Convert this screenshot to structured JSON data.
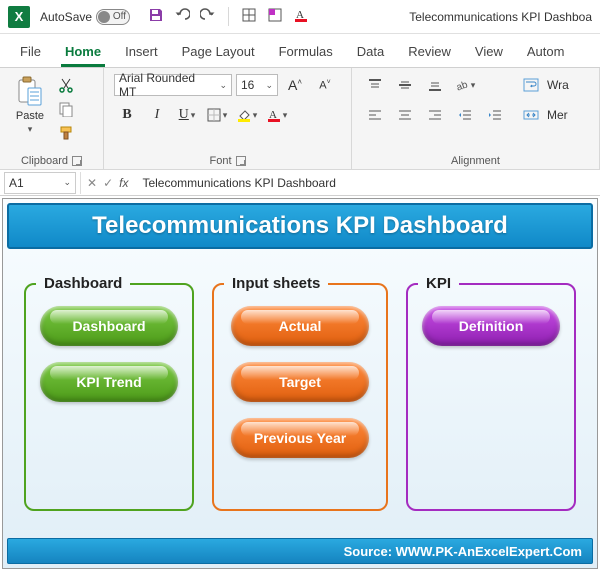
{
  "titlebar": {
    "autosave_label": "AutoSave",
    "autosave_state": "Off",
    "document_title": "Telecommunications KPI Dashboa"
  },
  "tabs": {
    "file": "File",
    "home": "Home",
    "insert": "Insert",
    "pagelayout": "Page Layout",
    "formulas": "Formulas",
    "data": "Data",
    "review": "Review",
    "view": "View",
    "automate": "Autom"
  },
  "ribbon": {
    "clipboard": {
      "label": "Clipboard",
      "paste": "Paste"
    },
    "font": {
      "label": "Font",
      "name": "Arial Rounded MT",
      "size": "16",
      "increase": "A",
      "decrease": "A",
      "bold": "B",
      "italic": "I",
      "underline": "U"
    },
    "alignment": {
      "label": "Alignment",
      "wrap": "Wra",
      "merge": "Mer"
    }
  },
  "formula_bar": {
    "namebox": "A1",
    "fx": "fx",
    "content": "Telecommunications KPI Dashboard"
  },
  "dashboard": {
    "title": "Telecommunications KPI Dashboard",
    "panels": {
      "dashboard": {
        "legend": "Dashboard",
        "btn1": "Dashboard",
        "btn2": "KPI Trend"
      },
      "inputs": {
        "legend": "Input sheets",
        "btn1": "Actual",
        "btn2": "Target",
        "btn3": "Previous Year"
      },
      "kpi": {
        "legend": "KPI",
        "btn1": "Definition"
      }
    },
    "footer": "Source: WWW.PK-AnExcelExpert.Com"
  }
}
